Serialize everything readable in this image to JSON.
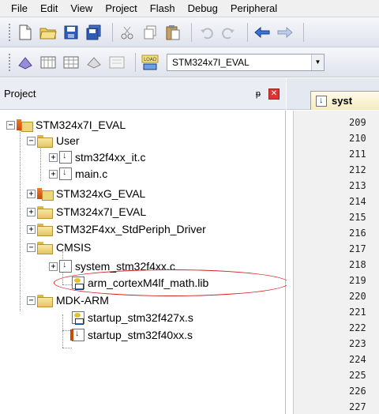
{
  "menu": [
    "File",
    "Edit",
    "View",
    "Project",
    "Flash",
    "Debug",
    "Peripheral"
  ],
  "toolbar1_icons": [
    "new-file-icon",
    "open-folder-icon",
    "save-icon",
    "save-all-icon",
    "cut-icon",
    "copy-icon",
    "paste-icon",
    "undo-icon",
    "redo-icon",
    "back-arrow-icon",
    "forward-arrow-icon"
  ],
  "toolbar2_icons": [
    "translate-icon",
    "build-icon",
    "rebuild-icon",
    "batch-build-icon",
    "stop-build-icon",
    "download-icon"
  ],
  "target_select": {
    "value": "STM324x7I_EVAL"
  },
  "project_panel": {
    "title": "Project",
    "pin": "ᵽ",
    "close": "✕"
  },
  "tree": {
    "root": "STM324x7I_EVAL",
    "user": "User",
    "stm32f4xx_it": "stm32f4xx_it.c",
    "main": "main.c",
    "g_eval": "STM324xG_EVAL",
    "i_eval": "STM324x7I_EVAL",
    "stdperiph": "STM32F4xx_StdPeriph_Driver",
    "cmsis": "CMSIS",
    "system": "system_stm32f4xx.c",
    "mathlib": "arm_cortexM4lf_math.lib",
    "mdk": "MDK-ARM",
    "startup427": "startup_stm32f427x.s",
    "startup40": "startup_stm32f40xx.s"
  },
  "editor": {
    "tab": "syst",
    "line_numbers": [
      "209",
      "210",
      "211",
      "212",
      "213",
      "214",
      "215",
      "216",
      "217",
      "218",
      "219",
      "220",
      "221",
      "222",
      "223",
      "224",
      "225",
      "226",
      "227"
    ]
  },
  "colors": {
    "highlight_ellipse": "#d62020",
    "toolbar_bg": "#dfe3ec"
  }
}
